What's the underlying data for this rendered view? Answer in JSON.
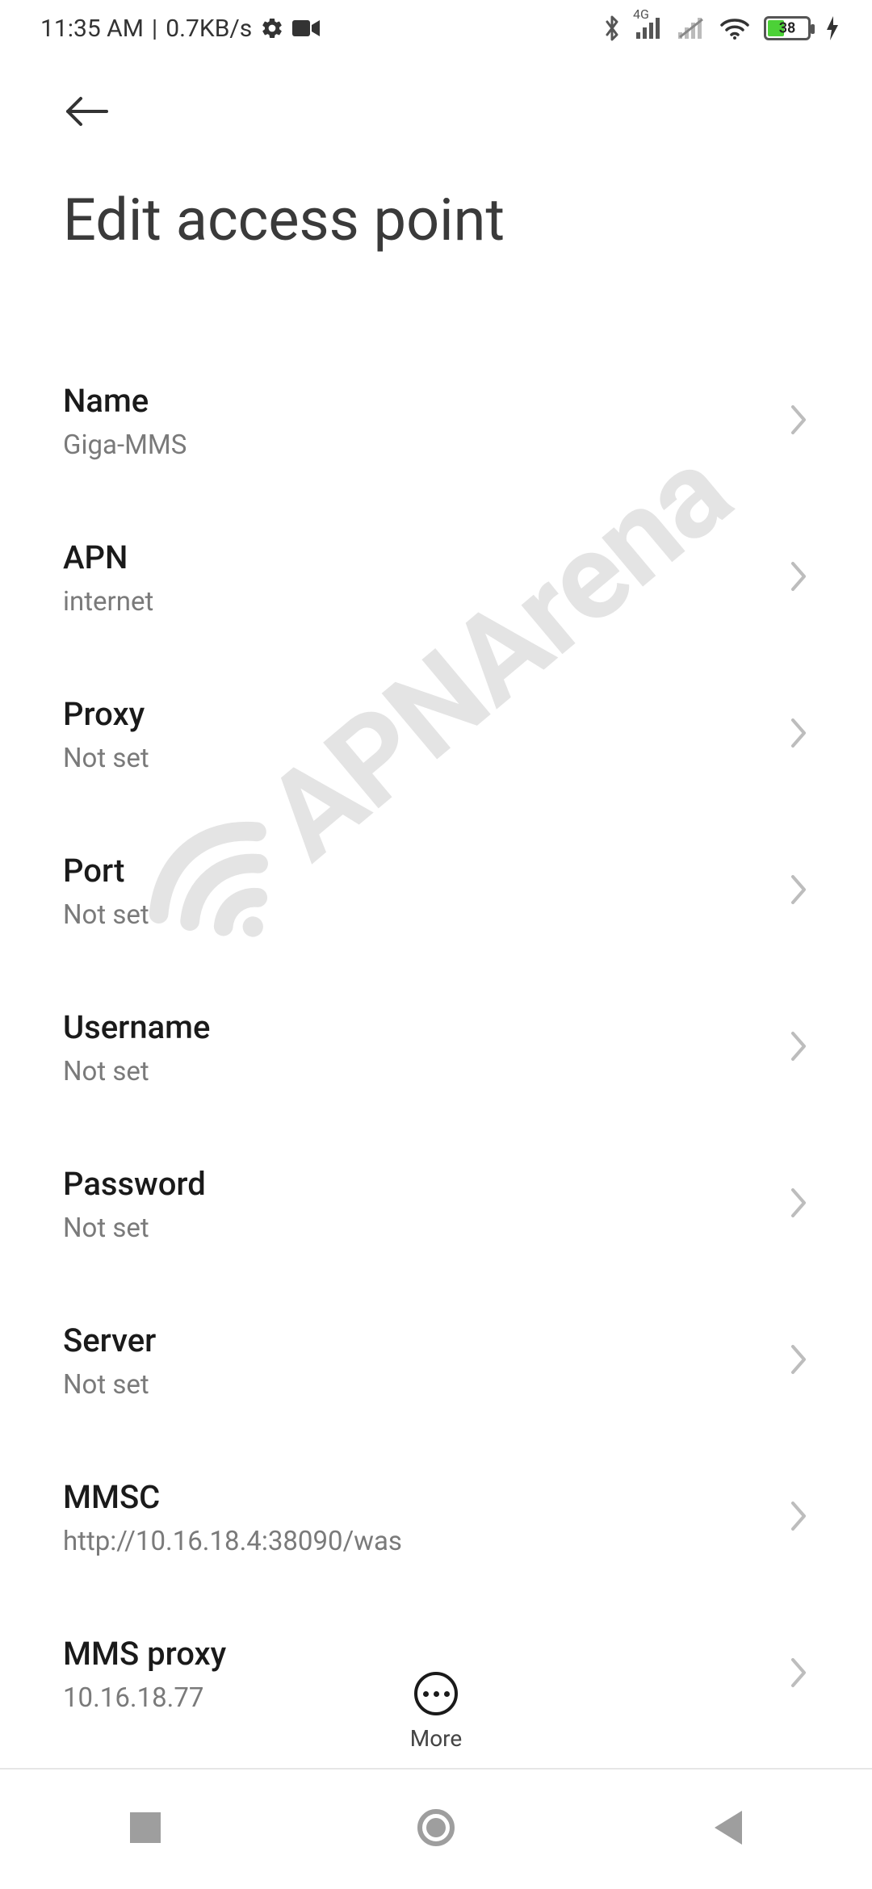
{
  "status": {
    "time": "11:35 AM",
    "net_speed": "0.7KB/s",
    "cell_label": "4G",
    "battery_pct": "38"
  },
  "header": {
    "title": "Edit access point"
  },
  "rows": [
    {
      "label": "Name",
      "value": "Giga-MMS"
    },
    {
      "label": "APN",
      "value": "internet"
    },
    {
      "label": "Proxy",
      "value": "Not set"
    },
    {
      "label": "Port",
      "value": "Not set"
    },
    {
      "label": "Username",
      "value": "Not set"
    },
    {
      "label": "Password",
      "value": "Not set"
    },
    {
      "label": "Server",
      "value": "Not set"
    },
    {
      "label": "MMSC",
      "value": "http://10.16.18.4:38090/was"
    },
    {
      "label": "MMS proxy",
      "value": "10.16.18.77"
    }
  ],
  "bottom": {
    "more_label": "More"
  },
  "watermark": {
    "text": "APNArena"
  }
}
